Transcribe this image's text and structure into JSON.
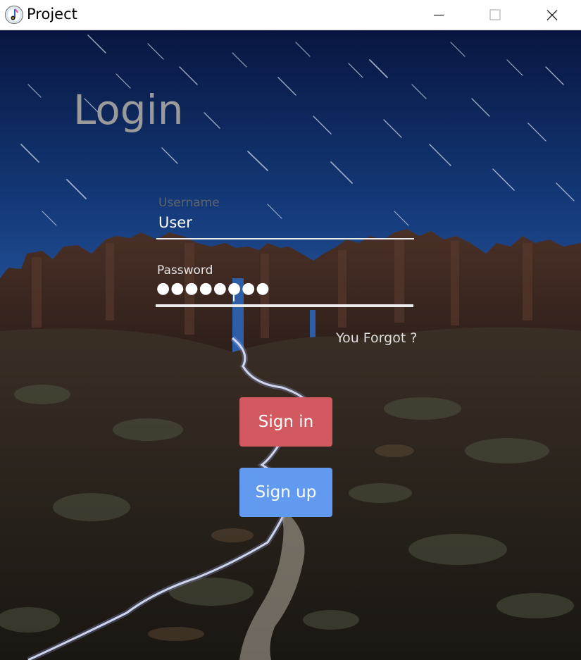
{
  "window": {
    "title": "Project",
    "app_icon": "music-note-icon"
  },
  "login": {
    "heading": "Login",
    "username_label": "Username",
    "username_value": "User",
    "password_label": "Password",
    "password_mask": "●●●●●●●●",
    "forgot_link": "You Forgot ?",
    "signin_label": "Sign in",
    "signup_label": "Sign up"
  },
  "colors": {
    "signin_button": "#d2595f",
    "signup_button": "#629af0",
    "heading": "#9a9a9a",
    "sky_top": "#0a1b44",
    "sky_bottom": "#1d4d93"
  }
}
